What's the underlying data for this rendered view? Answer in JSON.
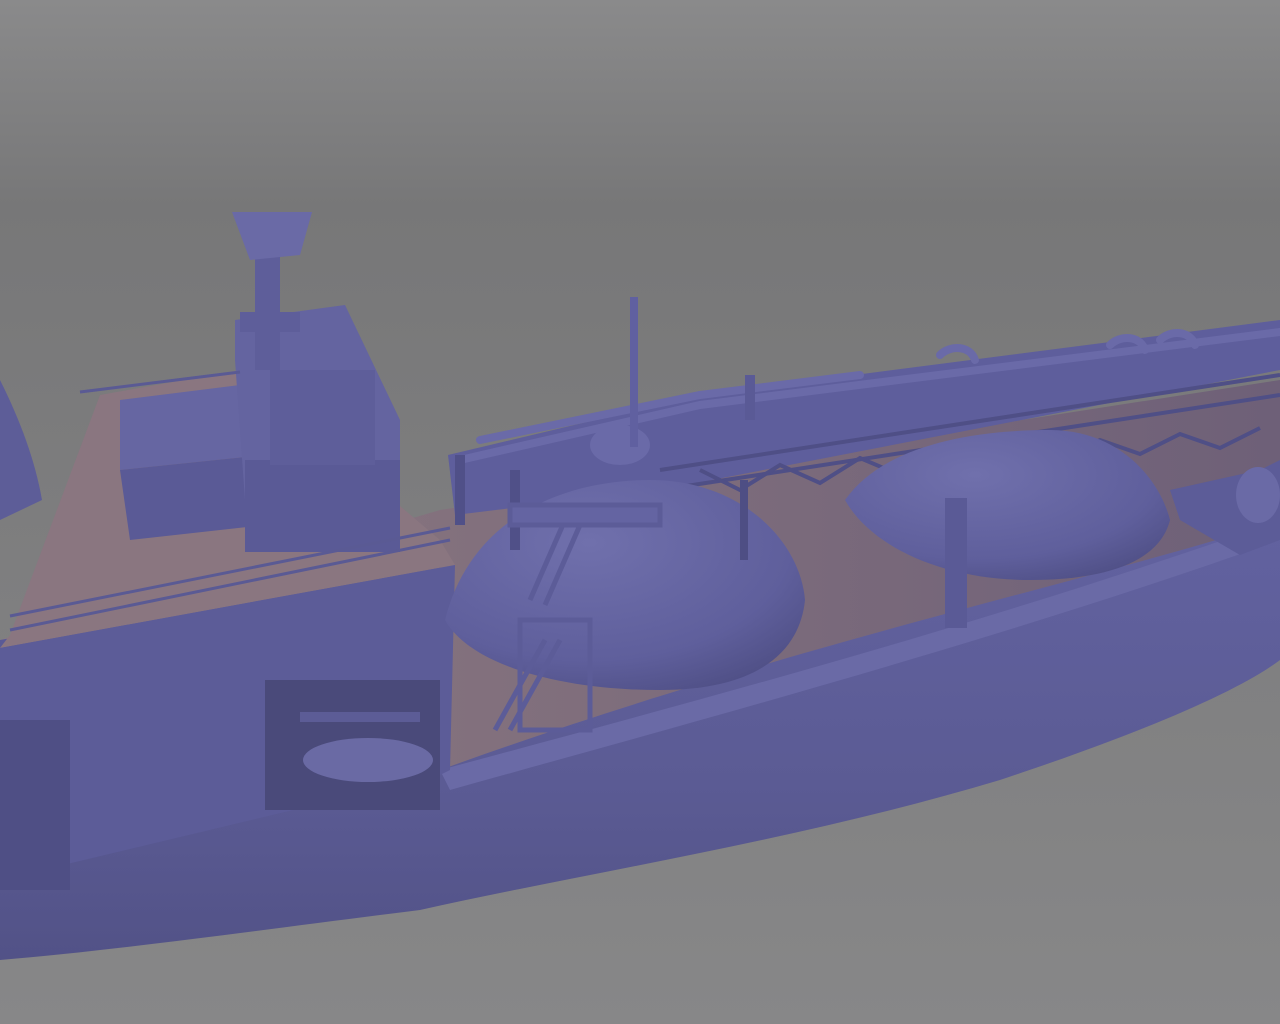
{
  "scene": {
    "subject": "lng-carrier-3d-model",
    "colors": {
      "background_top": "#8a8a8b",
      "background_band": "#777778",
      "background_bottom": "#878788",
      "hull": "#5b5b92",
      "hull_light": "#6868a0",
      "hull_shadow": "#45456f",
      "deck_wood": "#7d6a78",
      "deck_wood_light": "#8e7a80",
      "structure": "#6262a0",
      "structure_dark": "#4a4a7c",
      "dome": "#6464a2",
      "dome_shadow": "#4e4e84"
    }
  }
}
